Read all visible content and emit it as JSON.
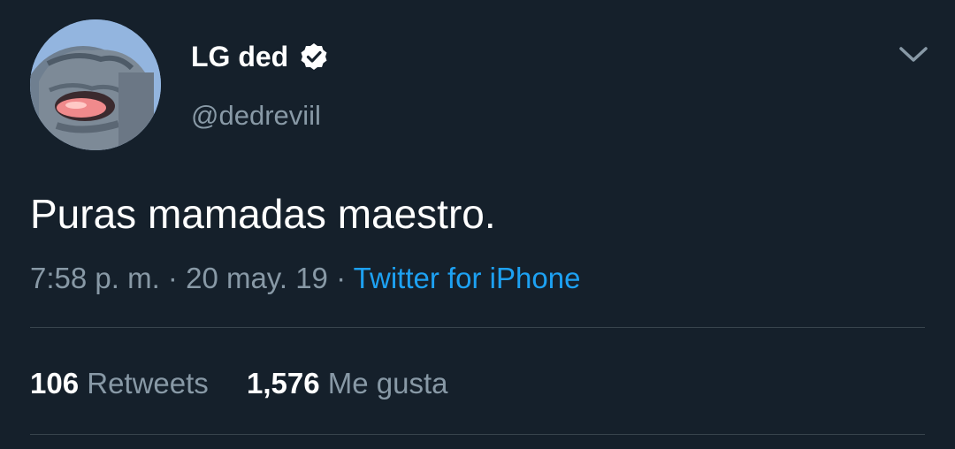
{
  "author": {
    "display_name": "LG ded",
    "username": "@dedreviil",
    "verified": true
  },
  "tweet": {
    "text": "Puras mamadas maestro.",
    "time": "7:58 p. m.",
    "separator": "·",
    "date": "20 may. 19",
    "source": "Twitter for iPhone"
  },
  "stats": {
    "retweets_count": "106",
    "retweets_label": "Retweets",
    "likes_count": "1,576",
    "likes_label": "Me gusta"
  },
  "colors": {
    "background": "#15202b",
    "primary_text": "#ffffff",
    "secondary_text": "#8899a6",
    "link": "#1da1f2",
    "divider": "#38444d"
  },
  "icons": {
    "verified": "verified-badge-icon",
    "menu": "chevron-down-icon"
  }
}
